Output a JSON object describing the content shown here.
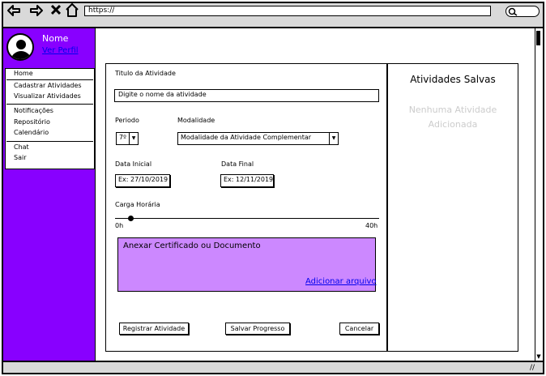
{
  "browser": {
    "url": "https://",
    "back_icon": "back-arrow-icon",
    "forward_icon": "forward-arrow-icon",
    "stop_icon": "close-icon",
    "home_icon": "home-icon",
    "search_icon": "search-icon"
  },
  "sidebar": {
    "profile_name": "Nome",
    "profile_link": "Ver Perfil",
    "menu_groups": [
      [
        "Home",
        "Cadastrar Atividades",
        "Visualizar Atividades"
      ],
      [
        "Notificações",
        "Repositório",
        "Calendário"
      ],
      [
        "Chat",
        "Sair"
      ]
    ],
    "colors": {
      "background": "#8800ff"
    }
  },
  "form": {
    "title_label": "Titulo da Atividade",
    "title_placeholder": "Digite o nome da atividade",
    "period_label": "Periodo",
    "period_value": "7º",
    "modality_label": "Modalidade",
    "modality_value": "Modalidade da Atividade Complementar",
    "start_label": "Data Inicial",
    "start_placeholder": "Ex: 27/10/2019",
    "end_label": "Data Final",
    "end_placeholder": "Ex: 12/11/2019",
    "hours_label": "Carga Horária",
    "hours_min": "0h",
    "hours_max": "40h",
    "hours_value_fraction": 0.06,
    "upload_title": "Anexar Certificado ou Documento",
    "upload_link": "Adicionar arquivo",
    "buttons": {
      "register": "Registrar Atividade",
      "save": "Salvar Progresso",
      "cancel": "Cancelar"
    },
    "colors": {
      "upload_background": "#cc88ff"
    }
  },
  "saved": {
    "title": "Atividades Salvas",
    "empty_line1": "Nenhuma Atividade",
    "empty_line2": "Adicionada"
  }
}
